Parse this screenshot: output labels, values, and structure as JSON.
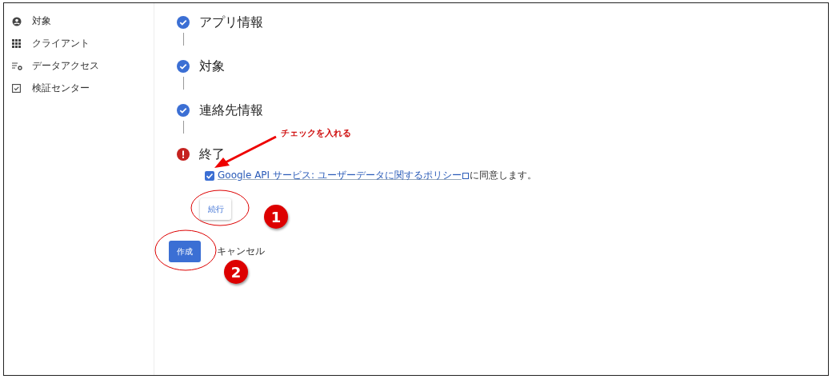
{
  "sidebar": {
    "items": [
      {
        "label": "対象",
        "kind": "account"
      },
      {
        "label": "クライアント",
        "kind": "grid"
      },
      {
        "label": "データアクセス",
        "kind": "data"
      },
      {
        "label": "検証センター",
        "kind": "verify"
      }
    ]
  },
  "steps": [
    {
      "title": "アプリ情報",
      "kind": "done"
    },
    {
      "title": "対象",
      "kind": "done"
    },
    {
      "title": "連絡先情報",
      "kind": "done"
    },
    {
      "title": "終了",
      "kind": "error"
    }
  ],
  "consent": {
    "checked": true,
    "link": "Google API サービス: ユーザーデータに関するポリシー",
    "suffix": "に同意します。"
  },
  "continue_button": "続行",
  "create_button": "作成",
  "cancel_button": "キャンセル",
  "annotations": {
    "note": "チェックを入れる",
    "markers": [
      "1",
      "2"
    ]
  }
}
